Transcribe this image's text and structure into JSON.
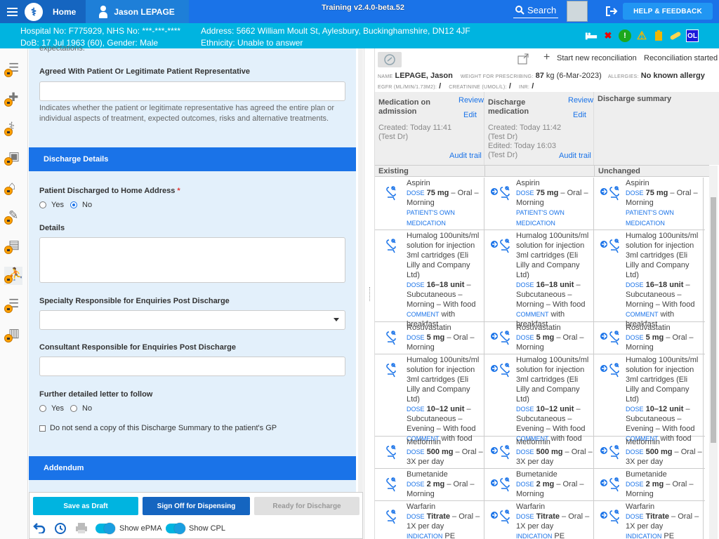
{
  "topbar": {
    "home": "Home",
    "patient_name": "Jason LEPAGE",
    "training": "Training v2.4.0-beta.52",
    "search": "Search",
    "help": "HELP & FEEDBACK"
  },
  "patient_banner": {
    "hospital": "Hospital No: F775929, NHS No: ***-***-****",
    "dob": "DoB: 17 Jul 1963 (60), Gender: Male",
    "address": "Address: 5662 William Moult St, Aylesbury, Buckinghamshire, DN12 4JF",
    "ethnicity": "Ethnicity: Unable to answer",
    "ol_badge": "OL"
  },
  "form": {
    "cut_text": "expectations.",
    "agreed_label": "Agreed With Patient Or Legitimate Patient Representative",
    "agreed_help_1": "Indicates whether the patient or legitimate representative has agreed the entire plan or",
    "agreed_help_2": "individual aspects of treatment, expected outcomes, risks and alternative treatments.",
    "discharge_section": "Discharge Details",
    "home_address_label": "Patient Discharged to Home Address",
    "required_mark": "*",
    "yes": "Yes",
    "no": "No",
    "details_label": "Details",
    "specialty_label": "Specialty Responsible for Enquiries Post Discharge",
    "consultant_label": "Consultant Responsible for Enquiries Post Discharge",
    "letter_label": "Further detailed letter to follow",
    "gp_checkbox": "Do not send a copy of this Discharge Summary to the patient's GP",
    "addendum_section": "Addendum"
  },
  "footer": {
    "save_draft": "Save as Draft",
    "sign_off": "Sign Off for Dispensing",
    "ready": "Ready for Discharge",
    "show_epma": "Show ePMA",
    "show_cpl": "Show CPL"
  },
  "reconciliation": {
    "start_new": "Start new reconciliation",
    "started": "Reconciliation started",
    "name_label": "NAME",
    "name": "LEPAGE, Jason",
    "weight_label": "WEIGHT FOR PRESCRIBING:",
    "weight": "87",
    "weight_unit": "kg (6-Mar-2023)",
    "allergies_label": "ALLERGIES:",
    "allergies": "No known allergy",
    "egfr_label": "EGFR (ML/MIN/1.73M2):",
    "creatinine_label": "CREATININE (UMOL/L):",
    "inr_label": "INR:",
    "slash": "/",
    "col1_title": "Medication on admission",
    "col2_title": "Discharge medication",
    "col3_title": "Discharge summary",
    "review": "Review",
    "edit": "Edit",
    "audit": "Audit trail",
    "col1_created": "Created: Today 11:41",
    "col1_by": "(Test Dr)",
    "col2_created": "Created: Today 11:42",
    "col2_by": "(Test Dr)",
    "col2_edited": "Edited: Today 16:03",
    "col2_by2": "(Test Dr)",
    "group_existing": "Existing",
    "group_unchanged": "Unchanged",
    "dose_k": "DOSE",
    "comment_k": "COMMENT",
    "indication_k": "INDICATION",
    "own_med": "PATIENT'S OWN MEDICATION"
  },
  "meds": [
    {
      "name": "Aspirin",
      "dose": "75 mg",
      "route": " – Oral – Morning",
      "own": true
    },
    {
      "name": "Humalog 100units/ml solution for injection 3ml cartridges (Eli Lilly and Company Ltd)",
      "dose": "16–18 unit",
      "route": " – Subcutaneous – Morning – With food",
      "comment": " with breakfast"
    },
    {
      "name": "Rosuvastatin",
      "dose": "5 mg",
      "route": " – Oral – Morning"
    },
    {
      "name": "Humalog 100units/ml solution for injection 3ml cartridges (Eli Lilly and Company Ltd)",
      "dose": "10–12 unit",
      "route": " – Subcutaneous – Evening – With food",
      "comment": " with food"
    },
    {
      "name": "Metformin",
      "dose": "500 mg",
      "route": " – Oral – 3X per day"
    },
    {
      "name": "Bumetanide",
      "dose": "2 mg",
      "route": " – Oral – Morning"
    },
    {
      "name": "Warfarin",
      "dose": "Titrate",
      "route": " – Oral – 1X per day",
      "indication": " PE"
    }
  ],
  "colors": {
    "primary": "#1a73e8",
    "banner": "#00b4e0",
    "lock": "#ffa000"
  }
}
